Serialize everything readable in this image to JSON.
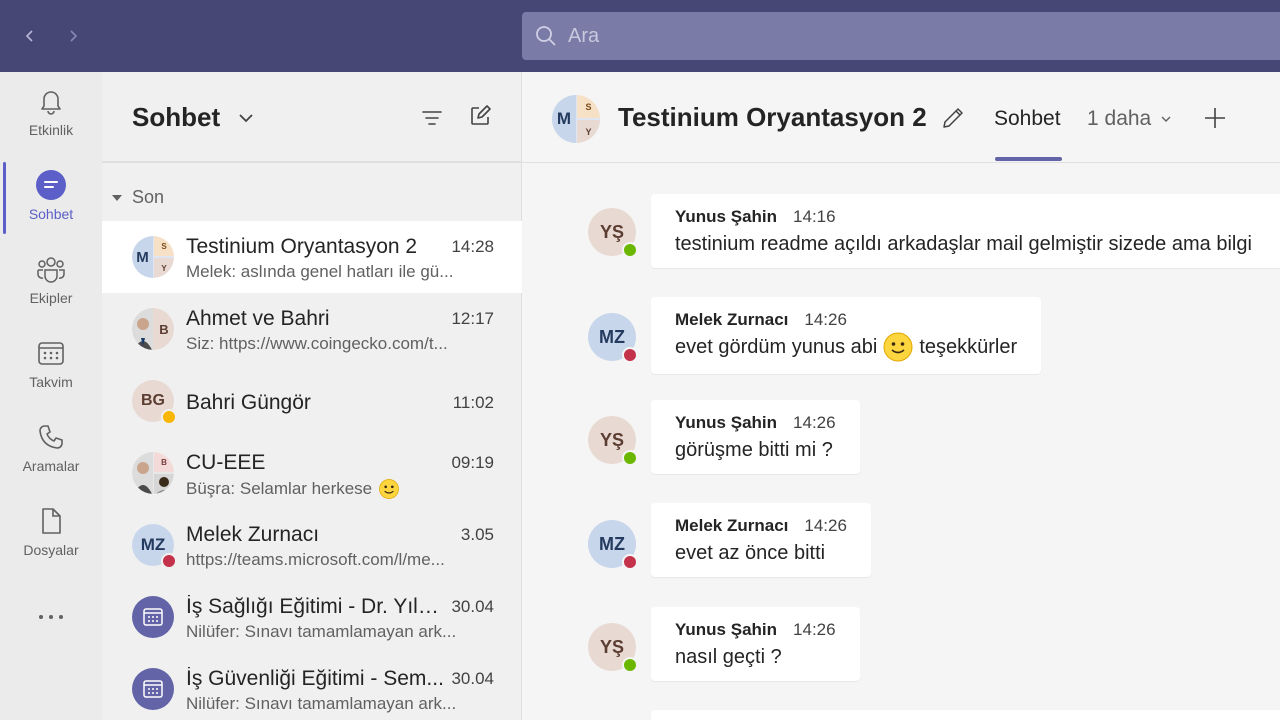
{
  "search": {
    "placeholder": "Ara"
  },
  "rail": {
    "items": [
      {
        "label": "Etkinlik",
        "icon": "bell-icon"
      },
      {
        "label": "Sohbet",
        "icon": "chat-icon"
      },
      {
        "label": "Ekipler",
        "icon": "teams-icon"
      },
      {
        "label": "Takvim",
        "icon": "calendar-icon"
      },
      {
        "label": "Aramalar",
        "icon": "phone-icon"
      },
      {
        "label": "Dosyalar",
        "icon": "file-icon"
      }
    ],
    "more_label": "..."
  },
  "chatlist": {
    "title": "Sohbet",
    "section": "Son",
    "items": [
      {
        "name": "Testinium Oryantasyon 2",
        "time": "14:28",
        "preview": "Melek: aslında genel hatları ile gü..."
      },
      {
        "name": "Ahmet ve Bahri",
        "time": "12:17",
        "preview": "Siz: https://www.coingecko.com/t..."
      },
      {
        "name": "Bahri Güngör",
        "time": "11:02",
        "preview": "",
        "initials": "BG"
      },
      {
        "name": "CU-EEE",
        "time": "09:19",
        "preview": "Büşra: Selamlar herkese"
      },
      {
        "name": "Melek Zurnacı",
        "time": "3.05",
        "preview": "https://teams.microsoft.com/l/me...",
        "initials": "MZ"
      },
      {
        "name": "İş Sağlığı Eğitimi - Dr. Yıld...",
        "time": "30.04",
        "preview": "Nilüfer: Sınavı tamamlamayan ark..."
      },
      {
        "name": "İş Güvenliği Eğitimi - Sem...",
        "time": "30.04",
        "preview": "Nilüfer: Sınavı tamamlamayan ark..."
      }
    ]
  },
  "group_avatar": {
    "letters": [
      "M",
      "S",
      "Y"
    ]
  },
  "pair_avatar": {
    "letter": "B"
  },
  "conversation": {
    "title": "Testinium Oryantasyon 2",
    "tab": "Sohbet",
    "more_tabs": "1 daha",
    "messages": [
      {
        "author": "Yunus Şahin",
        "initials": "YŞ",
        "time": "14:16",
        "text": "testinium readme açıldı arkadaşlar mail gelmiştir sizede ama bilgi"
      },
      {
        "author": "Melek Zurnacı",
        "initials": "MZ",
        "time": "14:26",
        "text_before": "evet gördüm yunus abi",
        "text_after": "teşekkürler"
      },
      {
        "author": "Yunus Şahin",
        "initials": "YŞ",
        "time": "14:26",
        "text": "görüşme bitti mi ?"
      },
      {
        "author": "Melek Zurnacı",
        "initials": "MZ",
        "time": "14:26",
        "text": "evet az önce bitti"
      },
      {
        "author": "Yunus Şahin",
        "initials": "YŞ",
        "time": "14:26",
        "text": "nasıl geçti ?"
      }
    ]
  },
  "colors": {
    "accent": "#6264a7",
    "topbar": "#464775",
    "presence_busy": "#c4314b",
    "presence_available": "#6bb700",
    "presence_away": "#f8b600"
  }
}
